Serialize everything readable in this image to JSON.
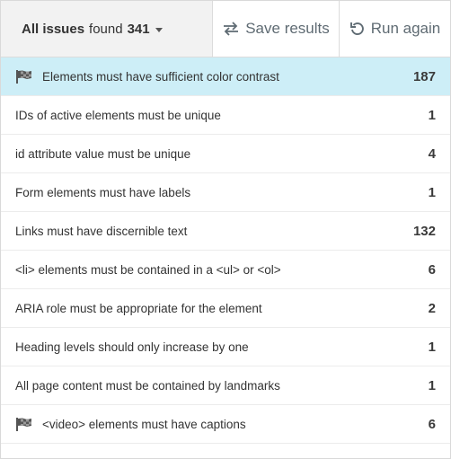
{
  "toolbar": {
    "filter_prefix": "All issues",
    "filter_word": "found",
    "filter_count": "341",
    "save_label": "Save results",
    "run_label": "Run again"
  },
  "issues": [
    {
      "label": "Elements must have sufficient color contrast",
      "count": "187",
      "flagged": true,
      "selected": true
    },
    {
      "label": "IDs of active elements must be unique",
      "count": "1"
    },
    {
      "label": "id attribute value must be unique",
      "count": "4"
    },
    {
      "label": "Form elements must have labels",
      "count": "1"
    },
    {
      "label": "Links must have discernible text",
      "count": "132"
    },
    {
      "label": "<li> elements must be contained in a <ul> or <ol>",
      "count": "6"
    },
    {
      "label": "ARIA role must be appropriate for the element",
      "count": "2"
    },
    {
      "label": "Heading levels should only increase by one",
      "count": "1"
    },
    {
      "label": "All page content must be contained by landmarks",
      "count": "1"
    },
    {
      "label": "<video> elements must have captions",
      "count": "6",
      "flagged": true
    }
  ],
  "icons": {
    "flag": "flag-icon",
    "save": "swap-arrows-icon",
    "run": "rotate-left-icon",
    "caret": "chevron-down-icon"
  }
}
